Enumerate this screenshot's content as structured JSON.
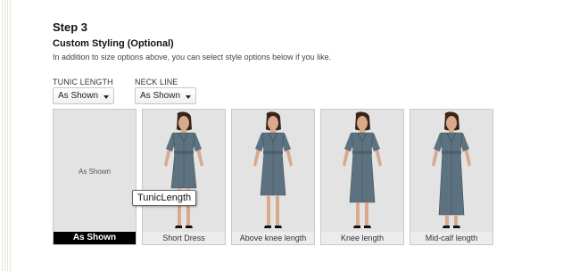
{
  "step": {
    "title": "Step 3"
  },
  "custom_styling": {
    "title": "Custom Styling (Optional)",
    "description": "In addition to size options above, you can select style options below if you like."
  },
  "fields": [
    {
      "label": "TUNIC LENGTH",
      "selected": "As Shown"
    },
    {
      "label": "NECK LINE",
      "selected": "As Shown"
    }
  ],
  "options": [
    {
      "caption": "As Shown",
      "placeholder": "As Shown",
      "selected": true
    },
    {
      "caption": "Short Dress",
      "selected": false
    },
    {
      "caption": "Above knee length",
      "selected": false
    },
    {
      "caption": "Knee length",
      "selected": false
    },
    {
      "caption": "Mid-calf length",
      "selected": false
    }
  ],
  "tooltip": {
    "text": "TunicLength"
  },
  "colors": {
    "dress": "#5d7280",
    "skin": "#d8a98c",
    "hair": "#3a2418",
    "card_background": "#e3e3e3",
    "selected_caption": "#000000"
  }
}
